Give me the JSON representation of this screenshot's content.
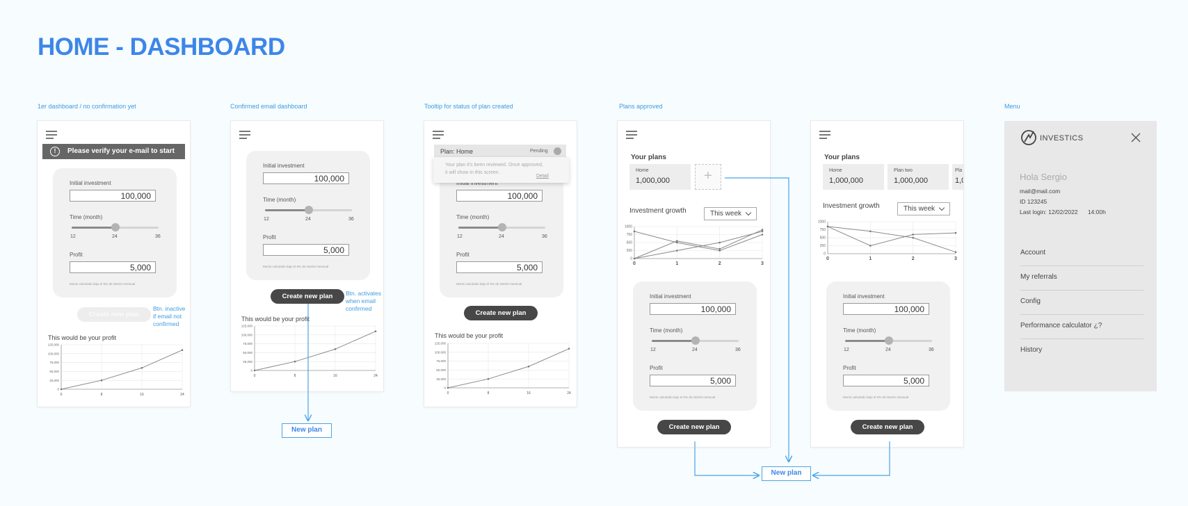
{
  "page_title": "HOME - DASHBOARD",
  "captions": {
    "s1": "1er dashboard / no confirmation yet",
    "s2": "Confirmed email dashboard",
    "s3": "Tooltip for status of plan created",
    "s4": "Plans approved",
    "s6": "Menu"
  },
  "calc": {
    "initial_label": "Initial investment",
    "initial_value": "100,000",
    "time_label": "Time (month)",
    "time_ticks": [
      "12",
      "24",
      "36"
    ],
    "time_value": 24,
    "time_min": 12,
    "time_max": 36,
    "profit_label": "Profit",
    "profit_value": "5,000",
    "note": "Monto calculado bajo el 5% de interés mensual"
  },
  "banner": {
    "text": "Please verify your e-mail to start",
    "icon": "!"
  },
  "buttons": {
    "create_plan": "Create new plan"
  },
  "annotations": {
    "inactive": [
      "Btn. inactive",
      "if email not",
      "confirmed"
    ],
    "activates": [
      "Btn. activates",
      "when email",
      "confirmed"
    ]
  },
  "new_plan_label": "New plan",
  "profit_section_title": "This would be your profit",
  "plan_tooltip": {
    "plan_name": "Plan: Home",
    "status": "Pending",
    "text_line1": "Your plan it's been reviewed. Once approved,",
    "text_line2": "it will show in this screen.",
    "detail": "Detail"
  },
  "plans": {
    "title": "Your plans",
    "add_symbol": "+",
    "cards_a": [
      {
        "name": "Home",
        "value": "1,000,000"
      }
    ],
    "cards_b": [
      {
        "name": "Home",
        "value": "1,000,000"
      },
      {
        "name": "Plan two",
        "value": "1,000,000"
      },
      {
        "name": "Pla",
        "value": "1,0"
      }
    ],
    "growth_title": "Investment growth",
    "period_select": "This week"
  },
  "menu": {
    "brand": "INVESTICS",
    "greeting": "Hola Sergio",
    "email": "mail@mail.com",
    "id": "ID 123245",
    "last_login": "Last login: 12/02/2022      14:00h",
    "items": [
      "Account",
      "My referrals",
      "Config",
      "Performance calculator ¿?",
      "History"
    ]
  },
  "chart_data": [
    {
      "type": "line",
      "title": "This would be your profit",
      "x": [
        0,
        8,
        16,
        24
      ],
      "xticks": [
        "0",
        "8",
        "16",
        "24"
      ],
      "series": [
        {
          "values": [
            0,
            25000,
            60000,
            110000
          ]
        }
      ],
      "yticks": [
        "0",
        "25,000",
        "50,000",
        "75,000",
        "100,000",
        "125,000"
      ],
      "ylim": [
        0,
        125000
      ],
      "grid": true
    },
    {
      "type": "line",
      "title": "Investment growth",
      "x": [
        0,
        1,
        2,
        3
      ],
      "xticks": [
        "0",
        "1",
        "2",
        "3"
      ],
      "yticks": [
        "0",
        "250",
        "500",
        "750",
        "1000"
      ],
      "ylim": [
        0,
        1000
      ],
      "series": [
        {
          "values": [
            0,
            250,
            500,
            850
          ]
        },
        {
          "values": [
            850,
            500,
            250,
            750
          ]
        },
        {
          "values": [
            0,
            550,
            300,
            900
          ]
        }
      ],
      "grid": true
    },
    {
      "type": "line",
      "title": "Investment growth",
      "x": [
        0,
        1,
        2,
        3
      ],
      "xticks": [
        "0",
        "1",
        "2",
        "3"
      ],
      "yticks": [
        "0",
        "250",
        "500",
        "750",
        "1000"
      ],
      "ylim": [
        0,
        1000
      ],
      "series": [
        {
          "values": [
            850,
            250,
            600,
            650
          ]
        },
        {
          "values": [
            850,
            700,
            500,
            50
          ]
        }
      ],
      "grid": true
    }
  ],
  "colors": {
    "title_blue": "#3d86e8",
    "annotation_blue": "#3d9be0",
    "dark_button": "#474747"
  }
}
